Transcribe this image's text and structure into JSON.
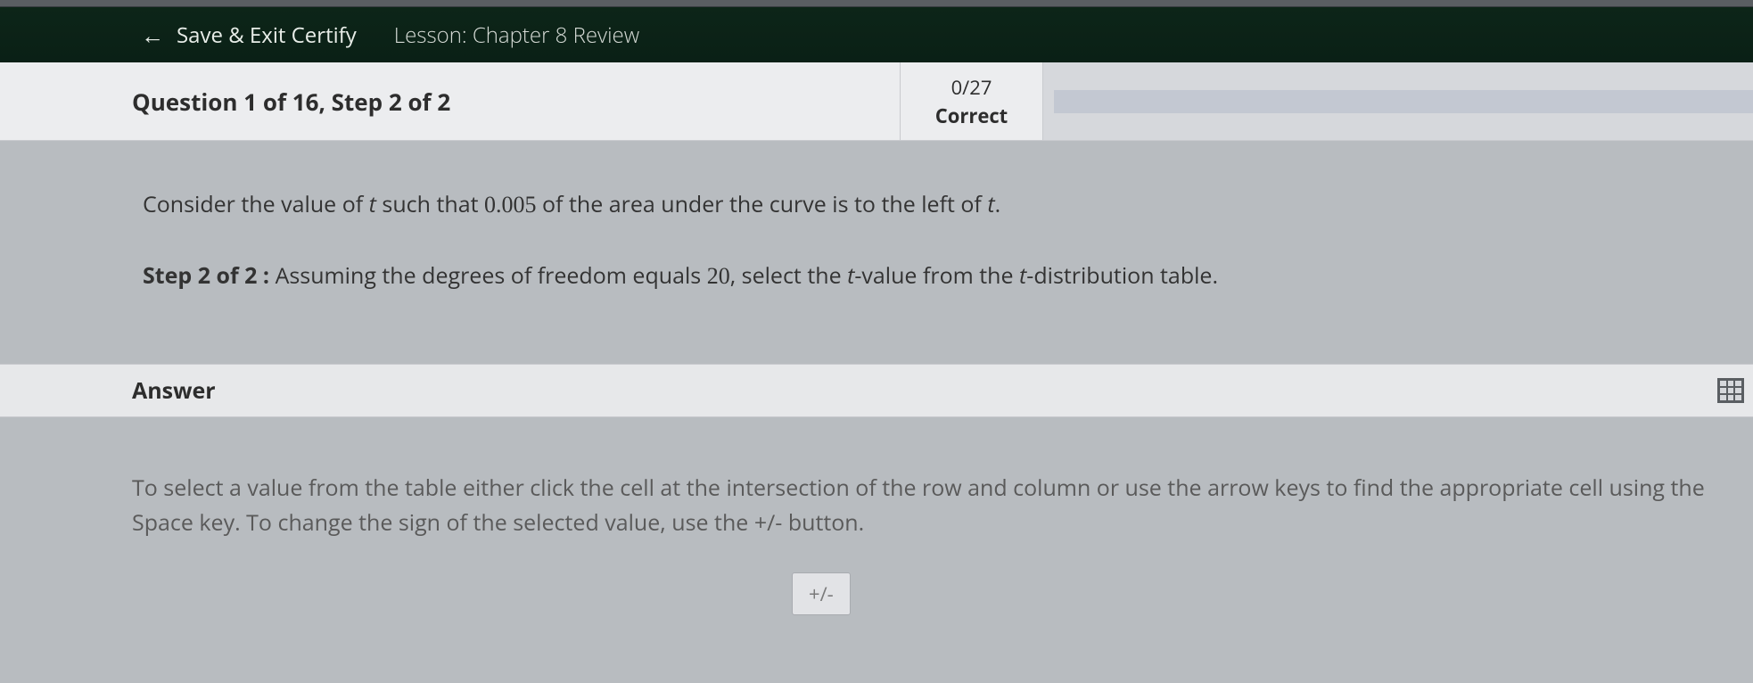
{
  "header": {
    "save_exit_label": "Save & Exit Certify",
    "lesson_label": "Lesson: Chapter 8 Review"
  },
  "question": {
    "title": "Question 1 of 16, Step 2 of 2",
    "score": "0/27",
    "correct_label": "Correct"
  },
  "prompt": {
    "pre": "Consider the value of ",
    "var1": "t",
    "mid1": " such that ",
    "num1": "0.005",
    "mid2": " of the area under the curve is to the left of ",
    "var2": "t",
    "end": "."
  },
  "step": {
    "label": "Step 2 of 2 :",
    "pre": "  Assuming the degrees of freedom equals ",
    "num": "20",
    "mid": ", select the ",
    "var1": "t",
    "mid2": "-value from the ",
    "var2": "t",
    "end": "-distribution table."
  },
  "answer": {
    "label": "Answer"
  },
  "instructions": {
    "text": "To select a value from the table either click the cell at the intersection of the row and column or use the arrow keys to find the appropriate cell using the Space key. To change the sign of the selected value, use the +/- button.",
    "sign_button": "+/-"
  }
}
